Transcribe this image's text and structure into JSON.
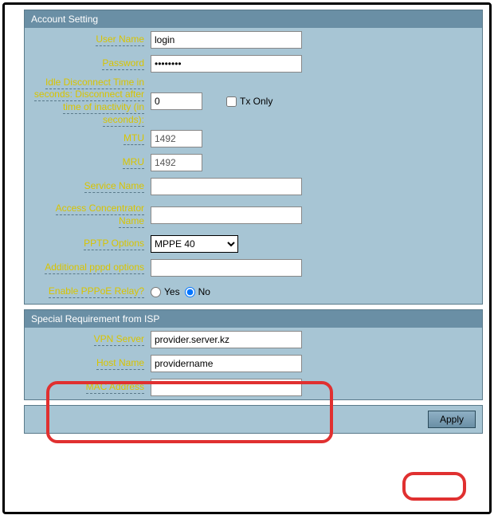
{
  "sections": {
    "account": {
      "title": "Account Setting",
      "username_label": "User Name",
      "username_value": "login",
      "password_label": "Password",
      "password_value": "••••••••",
      "idle_label": "Idle Disconnect Time in seconds: Disconnect after time of inactivity (in seconds):",
      "idle_value": "0",
      "txonly_label": "Tx Only",
      "mtu_label": "MTU",
      "mtu_value": "1492",
      "mru_label": "MRU",
      "mru_value": "1492",
      "service_label": "Service Name",
      "service_value": "",
      "ac_label": "Access Concentrator Name",
      "ac_value": "",
      "pptp_label": "PPTP Options",
      "pptp_value": "MPPE 40",
      "pppd_label": "Additional pppd options",
      "pppd_value": "",
      "relay_label": "Enable PPPoE Relay?",
      "yes_label": "Yes",
      "no_label": "No"
    },
    "isp": {
      "title": "Special Requirement from ISP",
      "vpn_label": "VPN Server",
      "vpn_value": "provider.server.kz",
      "host_label": "Host Name",
      "host_value": "providername",
      "mac_label": "MAC Address",
      "mac_value": ""
    },
    "apply_label": "Apply"
  }
}
